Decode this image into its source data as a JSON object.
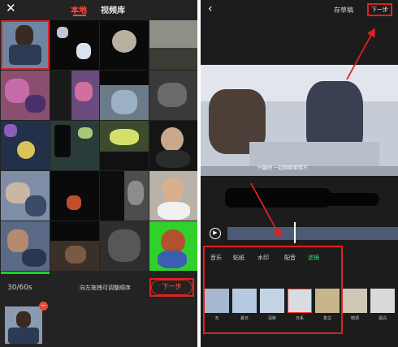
{
  "left_screen": {
    "tabs": [
      {
        "label": "本地",
        "active": true
      },
      {
        "label": "视频库",
        "active": false
      }
    ],
    "selection_count": "30/60s",
    "hint": "向左拖拽可调整顺序",
    "next_label": "下一步",
    "delete_glyph": "−"
  },
  "right_screen": {
    "back_glyph": "‹",
    "drafts_label": "存草稿",
    "next_label": "下一步",
    "video_caption": "兴趣吧 一起聊聊事情不",
    "edit_tabs": [
      {
        "label": "音乐"
      },
      {
        "label": "贴纸"
      },
      {
        "label": "水印"
      },
      {
        "label": "配音"
      },
      {
        "label": "滤镜",
        "active": true
      }
    ],
    "filters": [
      {
        "label": "无",
        "color": "#a6b8cf"
      },
      {
        "label": "夏日",
        "color": "#b5c9e0"
      },
      {
        "label": "清新",
        "color": "#c2d3e3"
      },
      {
        "label": "日系",
        "color": "#d8dde3",
        "selected": true
      },
      {
        "label": "复古",
        "color": "#c9b58a"
      },
      {
        "label": "暗调",
        "color": "#cfc8b6"
      },
      {
        "label": "黑白",
        "color": "#d9d9d9"
      }
    ]
  },
  "colors": {
    "accent_red": "#e02020",
    "active_tab_red": "#ff4b3e",
    "filter_active_green": "#2fe07a"
  }
}
